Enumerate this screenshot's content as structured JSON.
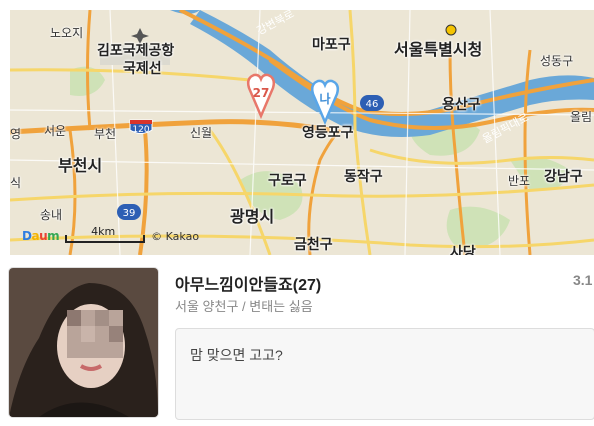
{
  "map": {
    "labels": {
      "noji": "노오지",
      "gimpo_airport": "김포국제공항",
      "international_line": "국제선",
      "gangbyeon": "강변북로",
      "mapo": "마포구",
      "seoul_city": "서울특별시청",
      "seongdong": "성동구",
      "yongsan": "용산구",
      "olympic": "올림픽대로",
      "seoul_w": "서운",
      "bucheon_small": "부천",
      "sinwol": "신월",
      "bucheon_city": "부천시",
      "yeongdeungpo": "영등포구",
      "guro": "구로구",
      "dongjak": "동작구",
      "banpo": "반포",
      "gangnam": "강남구",
      "gwangmyeong": "광명시",
      "songnae": "송내",
      "geumcheon": "금천구",
      "sadang": "사당",
      "yeong": "영",
      "sik": "식",
      "ollim": "올림"
    },
    "route_badges": [
      "120",
      "46",
      "39"
    ],
    "markers": [
      {
        "id": "pin-27",
        "label": "27",
        "color": "#e8776a"
      },
      {
        "id": "pin-na",
        "label": "나",
        "color": "#5aa6e8"
      }
    ],
    "scale_label": "4km",
    "copyright": "© Kakao",
    "logo_letters": [
      "D",
      "a",
      "u",
      "m"
    ]
  },
  "profile": {
    "name": "아무느낌이안들죠(27)",
    "subtitle": "서울 양천구 / 변태는 싫음",
    "metric": "3.1",
    "message": "맘 맞으면 고고?"
  }
}
